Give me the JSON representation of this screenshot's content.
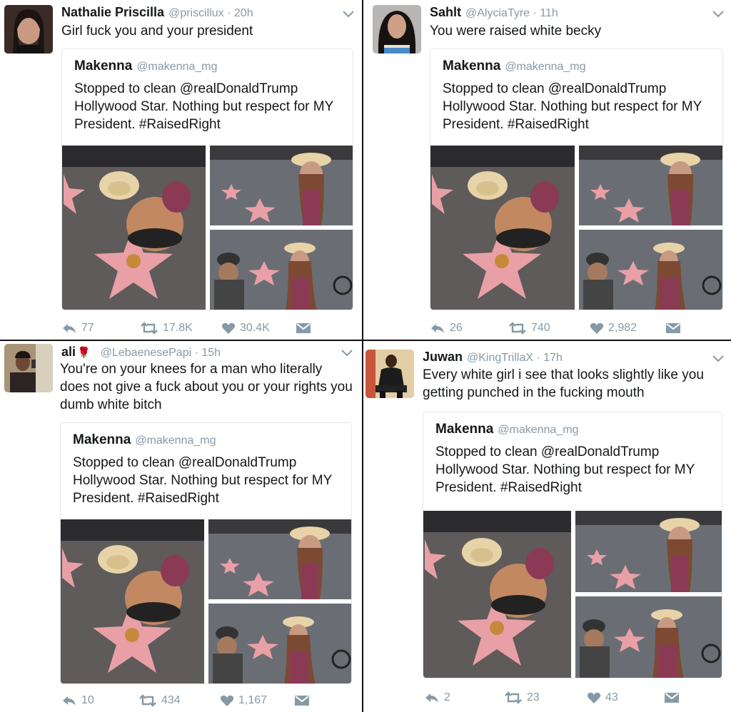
{
  "quoted": {
    "name": "Makenna",
    "handle": "@makenna_mg",
    "text": "Stopped to clean @realDonaldTrump Hollywood Star. Nothing but respect for MY President. #RaisedRight"
  },
  "tweets": [
    {
      "name": "Nathalie Priscilla",
      "handle": "@priscillux",
      "time": "20h",
      "text": "Girl fuck you and your president",
      "replies": "77",
      "retweets": "17.8K",
      "likes": "30.4K"
    },
    {
      "name": "Sahlt",
      "handle": "@AlyciaTyre",
      "time": "11h",
      "text": "You were raised white becky",
      "replies": "26",
      "retweets": "740",
      "likes": "2,982"
    },
    {
      "name": "ali",
      "handle": "@LebaenesePapi",
      "time": "15h",
      "text": "You're on your knees for a man who literally does not give a fuck about you or your rights you dumb white bitch",
      "replies": "10",
      "retweets": "434",
      "likes": "1,167"
    },
    {
      "name": "Juwan",
      "handle": "@KingTrillaX",
      "time": "17h",
      "text": "Every white girl i see that looks slightly like you getting punched in the fucking mouth",
      "replies": "2",
      "retweets": "23",
      "likes": "43"
    }
  ],
  "colors": {
    "text": "#14171a",
    "muted": "#8899a6",
    "border": "#e1e8ed",
    "star": "#e8a0a6",
    "divider": "#111111"
  },
  "icons": [
    "reply-icon",
    "retweet-icon",
    "like-icon",
    "direct-message-icon",
    "chevron-down-icon",
    "rose-emoji"
  ]
}
